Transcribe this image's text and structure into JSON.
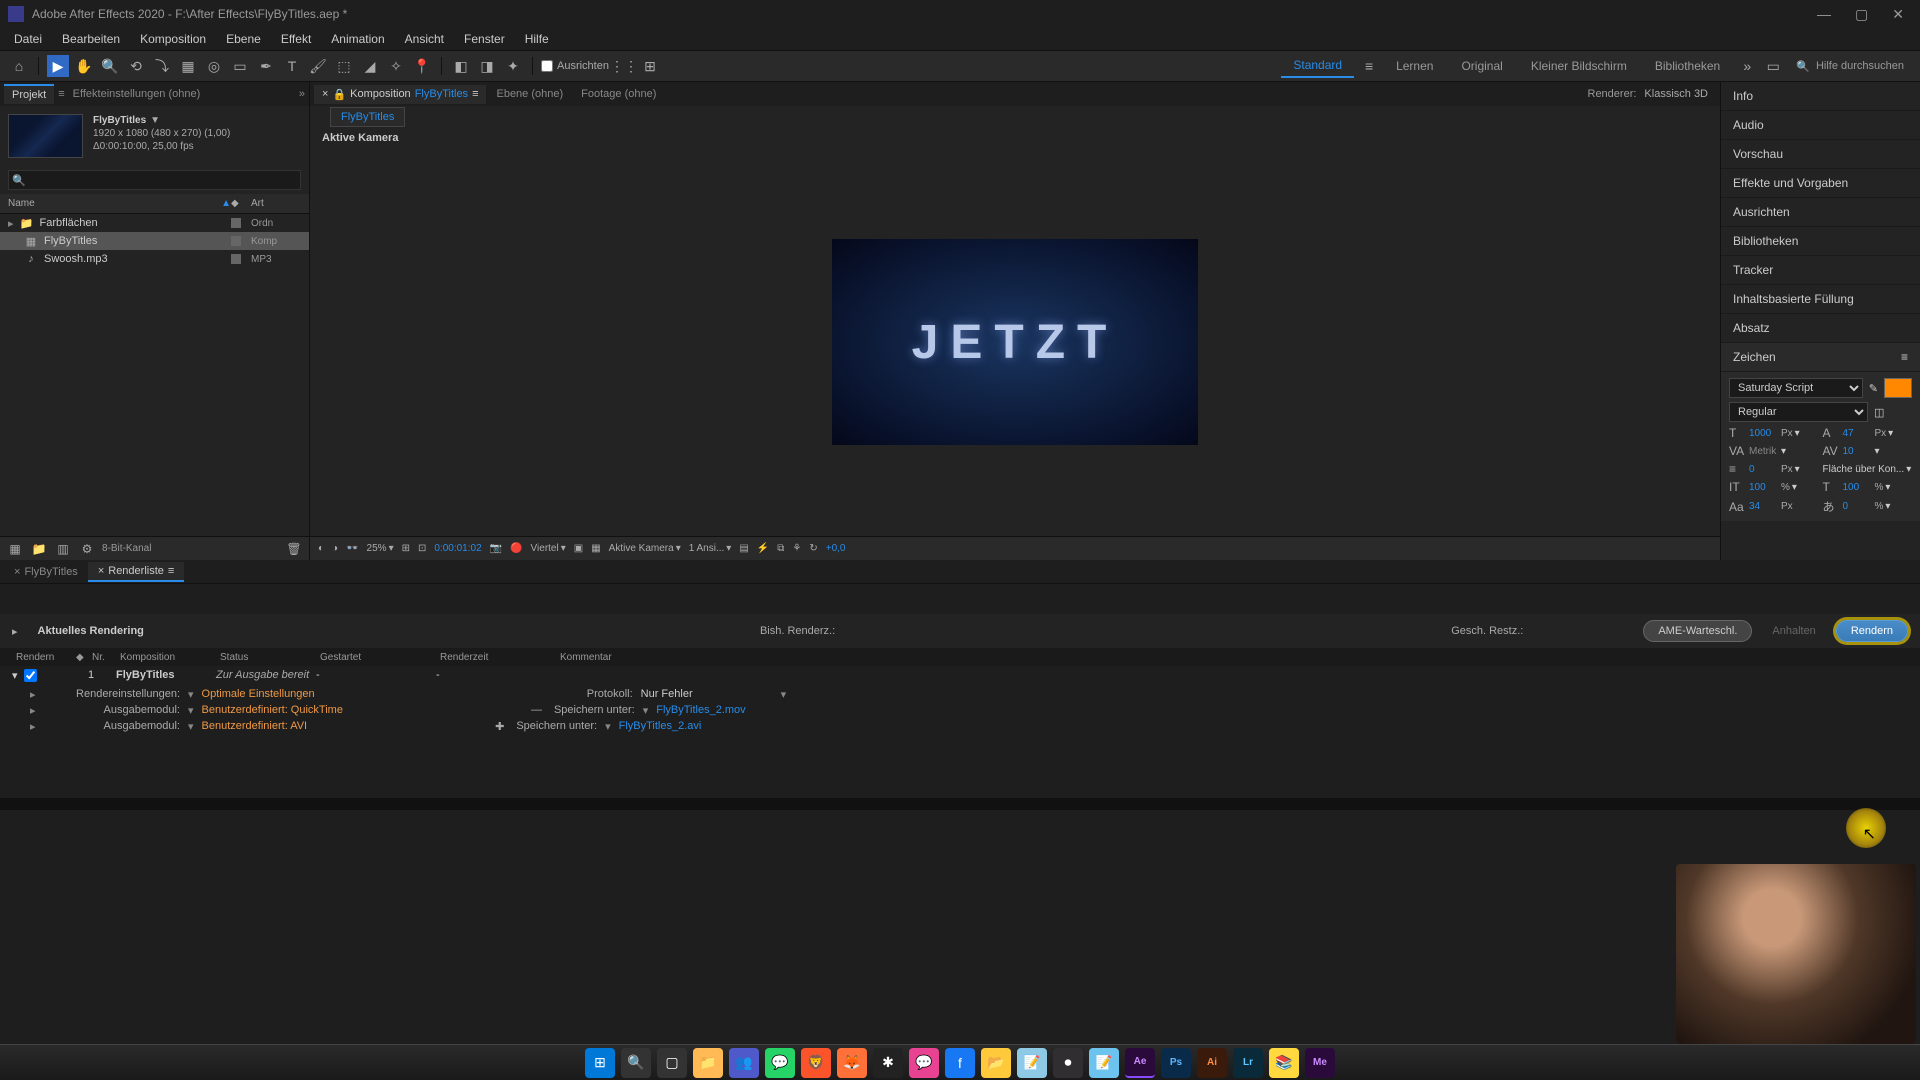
{
  "title": "Adobe After Effects 2020 - F:\\After Effects\\FlyByTitles.aep *",
  "menu": [
    "Datei",
    "Bearbeiten",
    "Komposition",
    "Ebene",
    "Effekt",
    "Animation",
    "Ansicht",
    "Fenster",
    "Hilfe"
  ],
  "toolbar": {
    "ausrichten": "Ausrichten"
  },
  "workspaces": {
    "items": [
      "Standard",
      "Lernen",
      "Original",
      "Kleiner Bildschirm",
      "Bibliotheken"
    ],
    "active": "Standard",
    "search_placeholder": "Hilfe durchsuchen"
  },
  "project": {
    "tab": "Projekt",
    "effects_tab": "Effekteinstellungen (ohne)",
    "comp_name": "FlyByTitles",
    "comp_dims": "1920 x 1080 (480 x 270) (1,00)",
    "comp_dur": "Δ0:00:10:00, 25,00 fps",
    "search_placeholder": "",
    "header_name": "Name",
    "header_type": "Art",
    "items": [
      {
        "name": "Farbflächen",
        "type": "Ordn",
        "icon": "folder",
        "expandable": true
      },
      {
        "name": "FlyByTitles",
        "type": "Komp",
        "icon": "comp",
        "selected": true
      },
      {
        "name": "Swoosh.mp3",
        "type": "MP3",
        "icon": "audio"
      }
    ],
    "footer_depth": "8-Bit-Kanal"
  },
  "viewer": {
    "comp_label": "Komposition",
    "comp_name": "FlyByTitles",
    "layer_tab": "Ebene (ohne)",
    "footage_tab": "Footage (ohne)",
    "renderer_label": "Renderer:",
    "renderer_value": "Klassisch 3D",
    "subtab": "FlyByTitles",
    "camera_label": "Aktive Kamera",
    "preview_text": "JETZT",
    "footer": {
      "zoom": "25%",
      "timecode": "0:00:01:02",
      "resolution": "Viertel",
      "camera": "Aktive Kamera",
      "views": "1 Ansi...",
      "exposure": "+0,0"
    }
  },
  "right_panels": {
    "items": [
      "Info",
      "Audio",
      "Vorschau",
      "Effekte und Vorgaben",
      "Ausrichten",
      "Bibliotheken",
      "Tracker",
      "Inhaltsbasierte Füllung",
      "Absatz"
    ],
    "zeichen": "Zeichen",
    "char": {
      "font": "Saturday Script",
      "weight": "Regular",
      "size": "1000",
      "leading": "47",
      "kerning": "Metrik",
      "tracking": "10",
      "stroke": "0",
      "stroke_opt": "Fläche über Kon...",
      "hscale": "100",
      "vscale": "100",
      "baseline": "34",
      "tsume": "0",
      "px": "Px",
      "pct": "%",
      "fill_color": "#ff8800"
    }
  },
  "bottom": {
    "tab_comp": "FlyByTitles",
    "tab_render": "Renderliste",
    "current_render": "Aktuelles Rendering",
    "bish_renderz": "Bish. Renderz.:",
    "gesch_restz": "Gesch. Restz.:",
    "ame_btn": "AME-Warteschl.",
    "anhalten_btn": "Anhalten",
    "rendern_btn": "Rendern",
    "headers": {
      "rendern": "Rendern",
      "nr": "Nr.",
      "komp": "Komposition",
      "status": "Status",
      "gestartet": "Gestartet",
      "renderzeit": "Renderzeit",
      "kommentar": "Kommentar"
    },
    "item": {
      "nr": "1",
      "name": "FlyByTitles",
      "status": "Zur Ausgabe bereit",
      "gestartet": "-",
      "renderzeit": "-"
    },
    "details": {
      "rendereinstellungen": "Rendereinstellungen:",
      "rendereinstellungen_val": "Optimale Einstellungen",
      "protokoll": "Protokoll:",
      "protokoll_val": "Nur Fehler",
      "ausgabemodul": "Ausgabemodul:",
      "ausgabemodul_val1": "Benutzerdefiniert: QuickTime",
      "ausgabemodul_val2": "Benutzerdefiniert: AVI",
      "speichern": "Speichern unter:",
      "speichern_val1": "FlyByTitles_2.mov",
      "speichern_val2": "FlyByTitles_2.avi"
    }
  }
}
